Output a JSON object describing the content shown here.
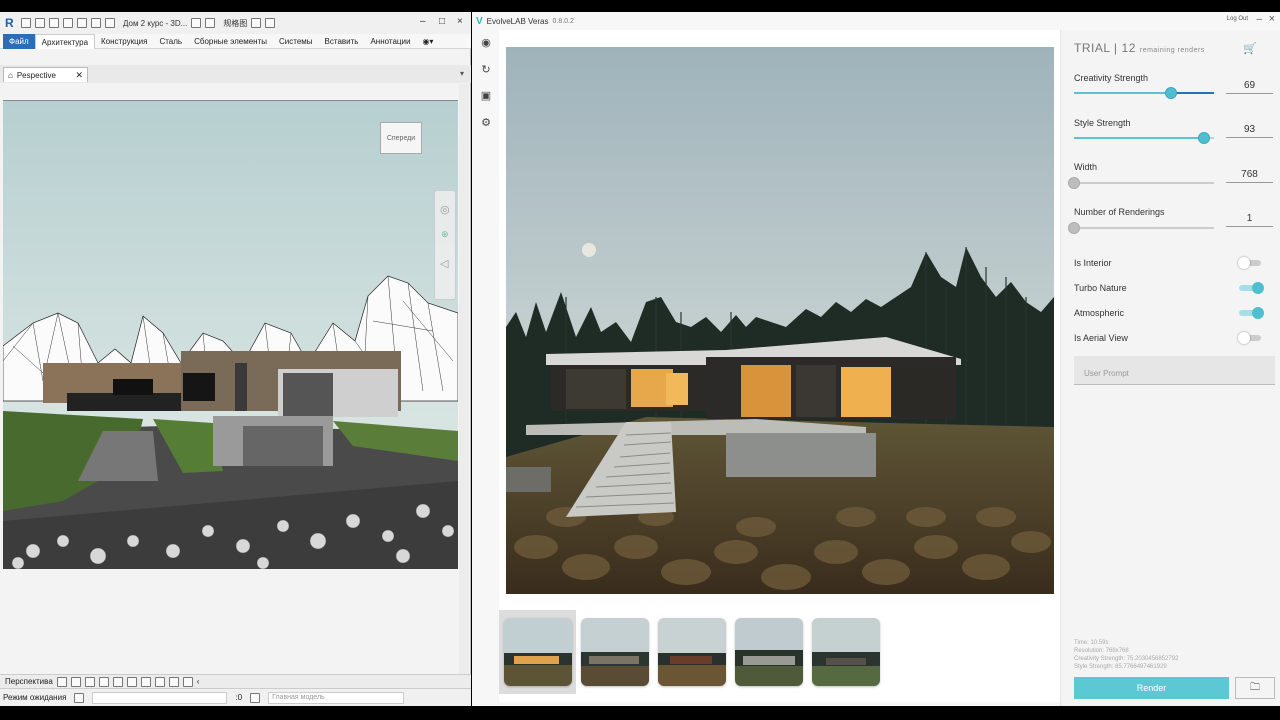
{
  "revit": {
    "app_letter": "R",
    "title": "Дом 2 курс - 3D...",
    "account": "规格图",
    "ribbon_tabs": [
      "Файл",
      "Архитектура",
      "Конструкция",
      "Сталь",
      "Сборные элементы",
      "Системы",
      "Вставить",
      "Аннотации"
    ],
    "view_tab": "Pespective",
    "viewcube_label": "Спереди",
    "view_name": "Перспектива",
    "status_text": "Режим ожидания",
    "status_zero": ":0",
    "model_dropdown": "Главная модель"
  },
  "veras": {
    "app_name": "EvolveLAB Veras",
    "version": "0.8.0.2",
    "logout": "Log Out",
    "trial_label": "TRIAL |",
    "renders_left": "12",
    "renders_left_label": "remaining renders",
    "sliders": [
      {
        "label": "Creativity Strength",
        "value": "69",
        "fraction": 0.69
      },
      {
        "label": "Style Strength",
        "value": "93",
        "fraction": 0.93
      },
      {
        "label": "Width",
        "value": "768",
        "fraction": 0.0
      },
      {
        "label": "Number of Renderings",
        "value": "1",
        "fraction": 0.0
      }
    ],
    "toggles": [
      {
        "label": "Is Interior",
        "on": false
      },
      {
        "label": "Turbo Nature",
        "on": true
      },
      {
        "label": "Atmospheric",
        "on": true
      },
      {
        "label": "Is Aerial View",
        "on": false
      }
    ],
    "prompt_placeholder": "User Prompt",
    "meta": {
      "time": "Time: 10.59s",
      "resolution": "Resolution: 768x768",
      "creativity": "Creativity Strength: 75.2030456852792",
      "style": "Style Strength: 85.7766497461929"
    },
    "render_button": "Render",
    "thumbnail_count": 5
  }
}
